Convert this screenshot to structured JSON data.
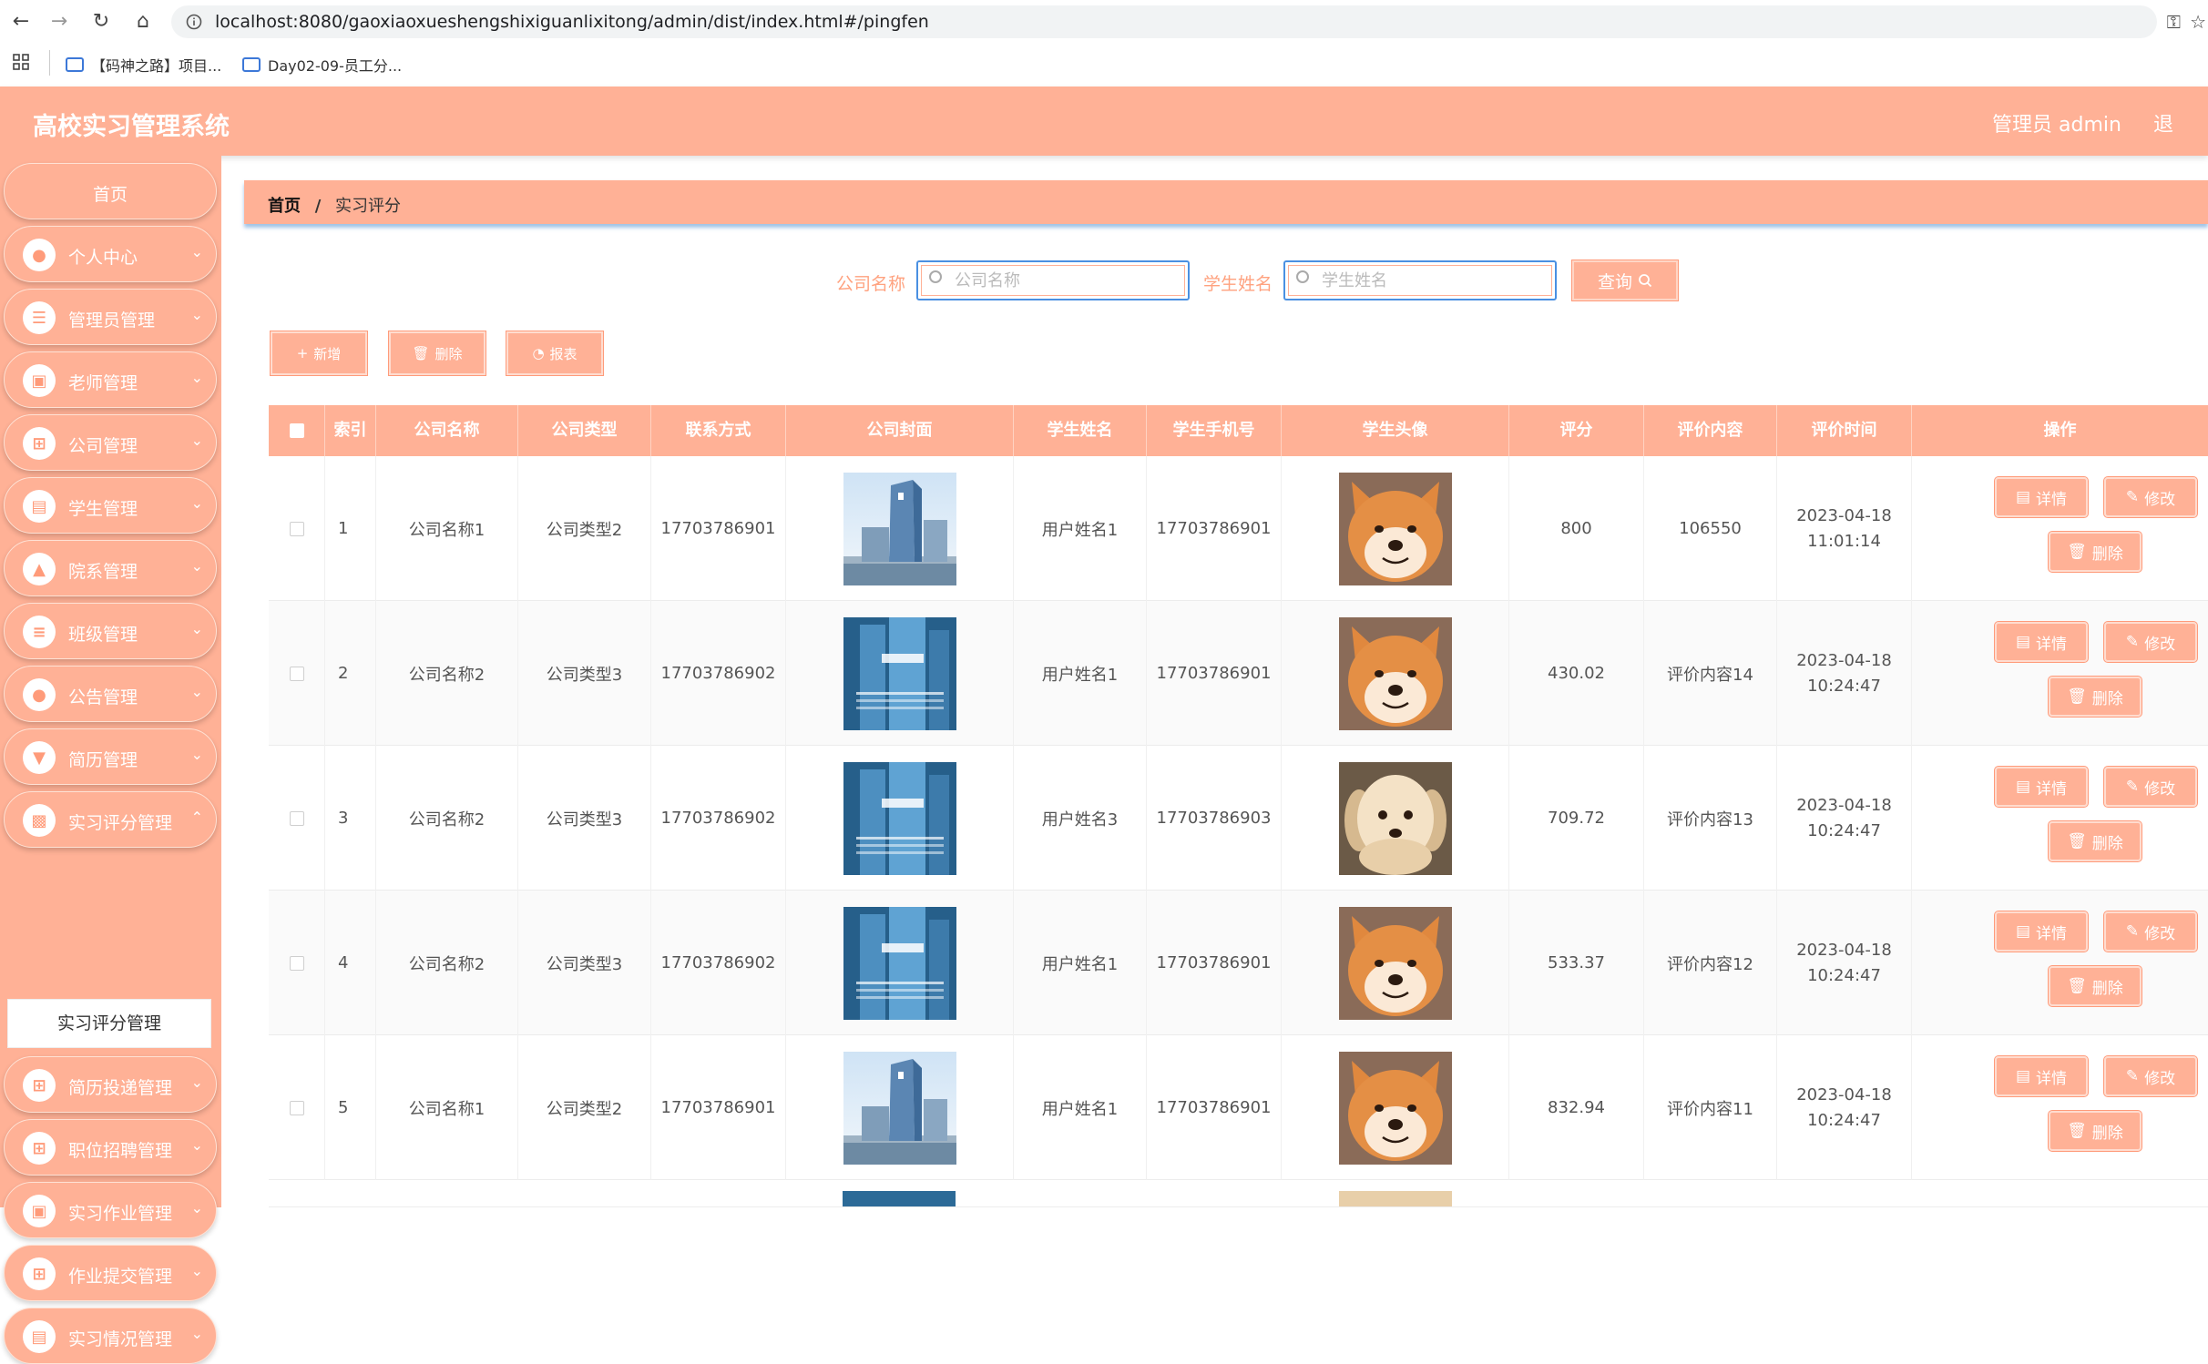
{
  "browser": {
    "url": "localhost:8080/gaoxiaoxueshengshixiguanlixitong/admin/dist/index.html#/pingfen",
    "bookmarks": [
      "【码神之路】项目...",
      "Day02-09-员工分..."
    ]
  },
  "header": {
    "title": "高校实习管理系统",
    "admin": "管理员 admin",
    "right_char": "退"
  },
  "sidebar": {
    "items": [
      {
        "label": "首页",
        "icon": "home-icon"
      },
      {
        "label": "个人中心",
        "icon": "user-icon"
      },
      {
        "label": "管理员管理",
        "icon": "list-icon"
      },
      {
        "label": "老师管理",
        "icon": "teacher-icon"
      },
      {
        "label": "公司管理",
        "icon": "grid-icon"
      },
      {
        "label": "学生管理",
        "icon": "student-icon"
      },
      {
        "label": "院系管理",
        "icon": "department-icon"
      },
      {
        "label": "班级管理",
        "icon": "class-icon"
      },
      {
        "label": "公告管理",
        "icon": "notice-icon"
      },
      {
        "label": "简历管理",
        "icon": "resume-icon"
      },
      {
        "label": "实习评分管理",
        "icon": "comment-icon"
      },
      {
        "label": "简历投递管理",
        "icon": "grid-icon"
      },
      {
        "label": "职位招聘管理",
        "icon": "grid-icon"
      },
      {
        "label": "实习作业管理",
        "icon": "homework-icon"
      },
      {
        "label": "作业提交管理",
        "icon": "grid-icon"
      },
      {
        "label": "实习情况管理",
        "icon": "chart-icon"
      }
    ],
    "active_sub": "实习评分管理"
  },
  "breadcrumb": {
    "home": "首页",
    "sep": "/",
    "current": "实习评分"
  },
  "search": {
    "company_label": "公司名称",
    "company_placeholder": "公司名称",
    "student_label": "学生姓名",
    "student_placeholder": "学生姓名",
    "query_label": "查询"
  },
  "actions": {
    "add": "新增",
    "delete": "删除",
    "report": "报表"
  },
  "table": {
    "headers": [
      "索引",
      "公司名称",
      "公司类型",
      "联系方式",
      "公司封面",
      "学生姓名",
      "学生手机号",
      "学生头像",
      "评分",
      "评价内容",
      "评价时间",
      "操作"
    ],
    "rows": [
      {
        "index": "1",
        "company": "公司名称1",
        "type": "公司类型2",
        "contact": "17703786901",
        "student": "用户姓名1",
        "phone": "17703786901",
        "score": "800",
        "content": "106550",
        "time": "2023-04-18 11:01:14"
      },
      {
        "index": "2",
        "company": "公司名称2",
        "type": "公司类型3",
        "contact": "17703786902",
        "student": "用户姓名1",
        "phone": "17703786901",
        "score": "430.02",
        "content": "评价内容14",
        "time": "2023-04-18 10:24:47"
      },
      {
        "index": "3",
        "company": "公司名称2",
        "type": "公司类型3",
        "contact": "17703786902",
        "student": "用户姓名3",
        "phone": "17703786903",
        "score": "709.72",
        "content": "评价内容13",
        "time": "2023-04-18 10:24:47"
      },
      {
        "index": "4",
        "company": "公司名称2",
        "type": "公司类型3",
        "contact": "17703786902",
        "student": "用户姓名1",
        "phone": "17703786901",
        "score": "533.37",
        "content": "评价内容12",
        "time": "2023-04-18 10:24:47"
      },
      {
        "index": "5",
        "company": "公司名称1",
        "type": "公司类型2",
        "contact": "17703786901",
        "student": "用户姓名1",
        "phone": "17703786901",
        "score": "832.94",
        "content": "评价内容11",
        "time": "2023-04-18 10:24:47"
      }
    ],
    "op_detail": "详情",
    "op_edit": "修改",
    "op_delete": "删除"
  },
  "colors": {
    "accent": "#ffb196",
    "accent_text": "#ffa27f",
    "focus": "#4a90e2"
  }
}
